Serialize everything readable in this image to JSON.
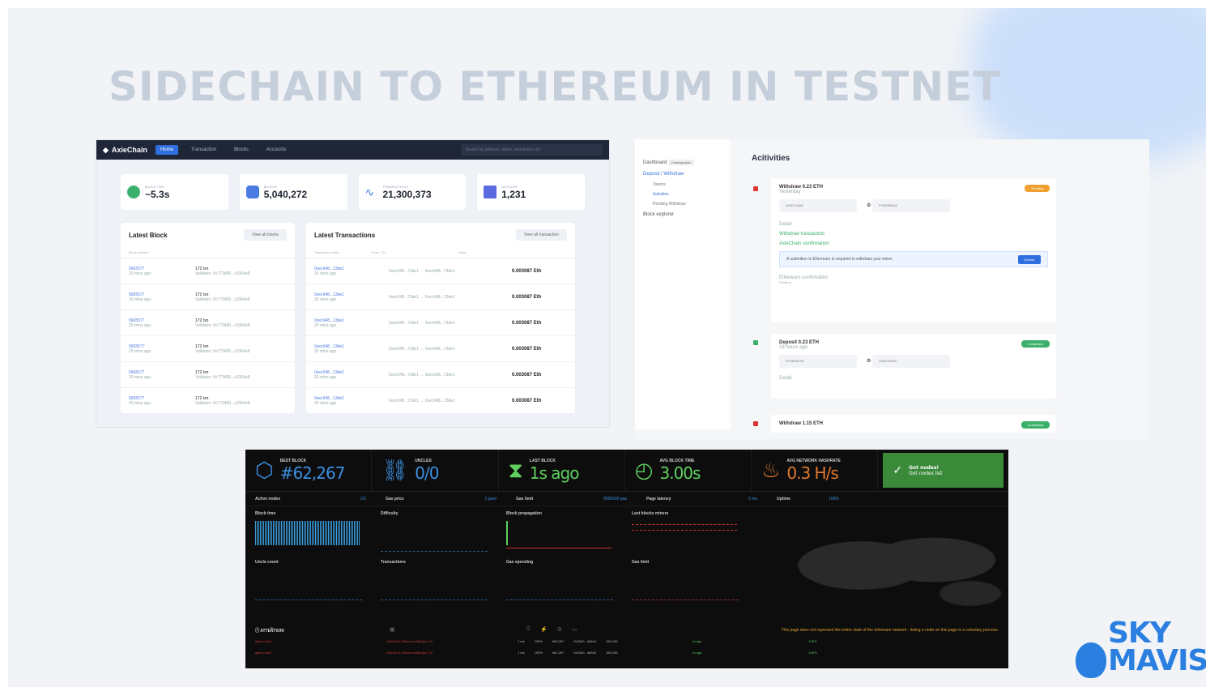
{
  "slide_title": "SIDECHAIN TO ETHEREUM IN TESTNET",
  "colors": {
    "accent": "#2f6fe0",
    "eth_blue": "#3c8fe0",
    "ok_green": "#3a8a3a",
    "pending": "#f0a030"
  },
  "axie": {
    "logo": "AxieChain",
    "nav": [
      "Home",
      "Transaction",
      "Blocks",
      "Accounts"
    ],
    "search_placeholder": "Search by address, token, transaction etc",
    "stats": [
      {
        "label": "Block time",
        "value": "~5.3s",
        "icon": "clock-icon",
        "color": "#3bb06a"
      },
      {
        "label": "Blocks",
        "value": "5,040,272",
        "icon": "cube-icon",
        "color": "#4a7be0"
      },
      {
        "label": "Transactions",
        "value": "21,300,373",
        "icon": "activity-icon",
        "color": "#4a7be0"
      },
      {
        "label": "Account",
        "value": "1,231",
        "icon": "book-icon",
        "color": "#5a6be0"
      }
    ],
    "latest_block": {
      "title": "Latest Block",
      "button": "View all blocks",
      "cols": [
        "Block number"
      ],
      "rows": [
        {
          "num": "5665577",
          "age": "20 mins ago",
          "txn": "172 txn",
          "val": "Validator: 0x773485...c3364e8"
        },
        {
          "num": "5665577",
          "age": "20 mins ago",
          "txn": "172 txn",
          "val": "Validator: 0x773485...c3364e8"
        },
        {
          "num": "5665577",
          "age": "20 mins ago",
          "txn": "172 txn",
          "val": "Validator: 0x773485...c3364e8"
        },
        {
          "num": "5665577",
          "age": "20 mins ago",
          "txn": "172 txn",
          "val": "Validator: 0x773485...c3364e8"
        },
        {
          "num": "5665577",
          "age": "20 mins ago",
          "txn": "172 txn",
          "val": "Validator: 0x773485...c3364e8"
        },
        {
          "num": "5665577",
          "age": "20 mins ago",
          "txn": "172 txn",
          "val": "Validator: 0x773485...c3364e8"
        }
      ]
    },
    "latest_tx": {
      "title": "Latest Transactions",
      "button": "View all transaction",
      "cols": [
        "Transaction hash",
        "From - To",
        "Value"
      ],
      "rows": [
        {
          "hash": "0xec948...13de1",
          "age": "20 mins ago",
          "from": "0xec948...73de1",
          "to": "0xec948...73de1",
          "value": "0.003087 Eth"
        },
        {
          "hash": "0xec948...13de1",
          "age": "20 mins ago",
          "from": "0xec948...73de1",
          "to": "0xec948...73de1",
          "value": "0.003087 Eth"
        },
        {
          "hash": "0xec948...13de1",
          "age": "20 mins ago",
          "from": "0xec948...73de1",
          "to": "0xec948...73de1",
          "value": "0.003087 Eth"
        },
        {
          "hash": "0xec948...13de1",
          "age": "20 mins ago",
          "from": "0xec948...73de1",
          "to": "0xec948...73de1",
          "value": "0.003087 Eth"
        },
        {
          "hash": "0xec948...13de1",
          "age": "20 mins ago",
          "from": "0xec948...73de1",
          "to": "0xec948...73de1",
          "value": "0.003087 Eth"
        },
        {
          "hash": "0xec948...13de1",
          "age": "20 mins ago",
          "from": "0xec948...73de1",
          "to": "0xec948...73de1",
          "value": "0.003087 Eth"
        }
      ]
    }
  },
  "activities": {
    "side": {
      "top": "Dashboard",
      "top_badge": "Coming soon",
      "section": "Deposit / Withdraw",
      "subs": [
        "Tokens",
        "Activities",
        "Pending Withdraw"
      ],
      "explorer": "Block explorer"
    },
    "title": "Acitivities",
    "cards": [
      {
        "title": "Withdraw 0.23 ETH",
        "time": "Yesterday",
        "badge": "Pending",
        "from": "AXIECHAIN",
        "to": "ETHEREUM",
        "detail": "Detail",
        "steps": [
          "Withdraw transaction",
          "AxieChain confirmation"
        ],
        "note": "A submition to Ethereum is required to withdraw your token",
        "submit": "Submit",
        "eth_step": "Ethereum confirmation",
        "eth_sub": "Pending"
      },
      {
        "title": "Deposit 0.23 ETH",
        "time": "18 hours ago",
        "badge": "Completed",
        "from": "ETHEREUM",
        "to": "AXIECHAIN",
        "detail": "Detail"
      },
      {
        "title": "Withdraw 1.15 ETH",
        "badge": "Completed"
      }
    ]
  },
  "eth": {
    "kpis": [
      {
        "label": "Best block",
        "value": "#62,267",
        "icon": "cube-icon"
      },
      {
        "label": "Uncles",
        "value": "0/0",
        "icon": "link-icon"
      },
      {
        "label": "Last block",
        "value": "1s ago",
        "icon": "hourglass-icon"
      },
      {
        "label": "Avg block time",
        "value": "3.00s",
        "icon": "clock-icon"
      },
      {
        "label": "Avg network hashrate",
        "value": "0.3 H/s",
        "icon": "flame-icon"
      }
    ],
    "ok": {
      "title": "Got nodes!",
      "sub": "Got nodes list"
    },
    "subs": [
      {
        "label": "Active nodes",
        "value": "2/2"
      },
      {
        "label": "Gas price",
        "value": "1 gwei"
      },
      {
        "label": "Gas limit",
        "value": "8000000 gas"
      },
      {
        "label": "Page latency",
        "value": "0 ms"
      },
      {
        "label": "Uptime",
        "value": "100%"
      }
    ],
    "panels": [
      "Block time",
      "Difficulty",
      "Block propagation",
      "Last blocks miners",
      "Uncle count",
      "Transactions",
      "Gas spending",
      "Gas limit"
    ],
    "attention": "ATTENTION!",
    "attention_text": "This page does not represent the entire state of the ethereum network - listing a node on this page is a voluntary process.",
    "nodes": [
      {
        "name": "geth-node1",
        "info": "Geth/v1.8.2/linux-amd64/go1.10",
        "lat": "1 ms",
        "peers": "100%",
        "block": "#62,267",
        "hash": "0x0340...4b5d4",
        "txs": "165,198",
        "ago": "1s ago",
        "up": "100%"
      },
      {
        "name": "geth-node2",
        "info": "Geth/v1.8.2/linux-amd64/go1.10",
        "lat": "1 ms",
        "peers": "100%",
        "block": "#62,267",
        "hash": "0x0340...4b5d4",
        "txs": "165,198",
        "ago": "1s ago",
        "up": "100%"
      }
    ]
  },
  "logo": {
    "line1": "SKY",
    "line2": "MAVIS"
  }
}
